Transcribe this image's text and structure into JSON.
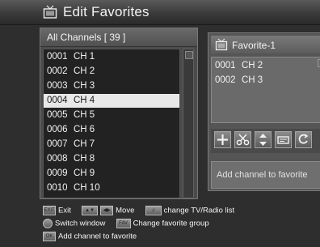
{
  "screen": {
    "title": "Edit Favorites",
    "title_icon": "tv-icon"
  },
  "channel_list": {
    "header": "All Channels  [ 39 ]",
    "selected_index": 3,
    "items": [
      {
        "num": "0001",
        "name": "CH 1"
      },
      {
        "num": "0002",
        "name": "CH 2"
      },
      {
        "num": "0003",
        "name": "CH 3"
      },
      {
        "num": "0004",
        "name": "CH 4"
      },
      {
        "num": "0005",
        "name": "CH 5"
      },
      {
        "num": "0006",
        "name": "CH 6"
      },
      {
        "num": "0007",
        "name": "CH 7"
      },
      {
        "num": "0008",
        "name": "CH 8"
      },
      {
        "num": "0009",
        "name": "CH 9"
      },
      {
        "num": "0010",
        "name": "CH 10"
      }
    ]
  },
  "favorite_panel": {
    "group_name": "Favorite-1",
    "items": [
      {
        "num": "0001",
        "name": "CH 2"
      },
      {
        "num": "0002",
        "name": "CH 3"
      }
    ],
    "tools": [
      "add-icon",
      "cut-icon",
      "move-icon",
      "rename-icon",
      "delete-icon"
    ],
    "status": "Add channel to favorite"
  },
  "help": {
    "exit_key": "EXIT",
    "exit": "Exit",
    "move": "Move",
    "tvradio": "change TV/Radio list",
    "switch": "Switch window",
    "fav_key": "FAV",
    "change_group": "Change favorite group",
    "ok_key": "OK",
    "add": "Add channel to favorite"
  },
  "colors": {
    "background": "#2e2e2e",
    "selected_row": "#e8e8e8",
    "list_bg": "#222222"
  }
}
